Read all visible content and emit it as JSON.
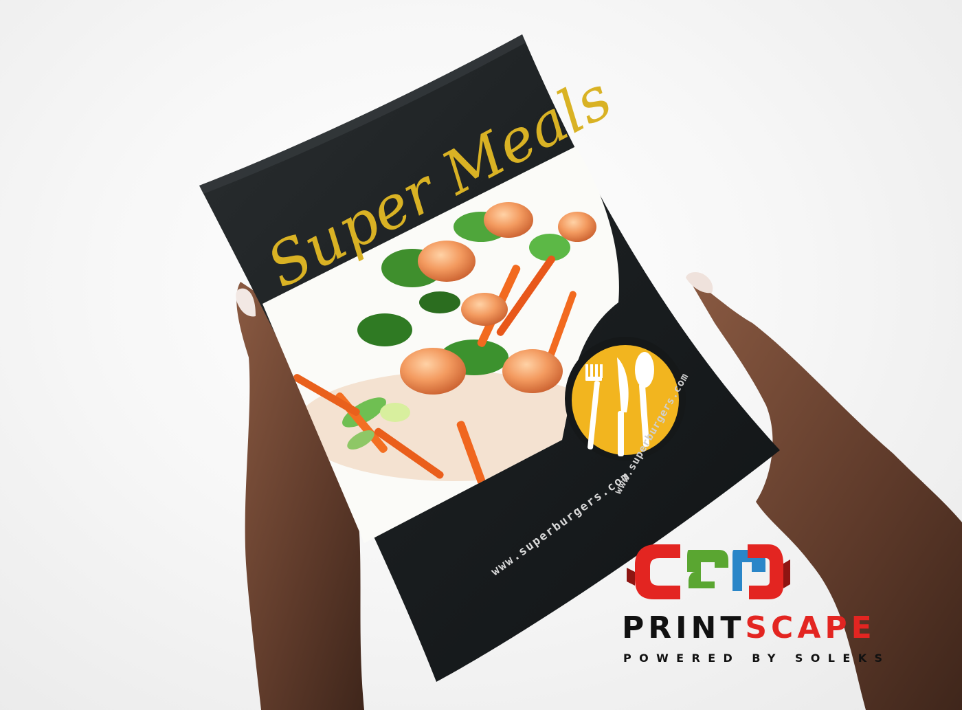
{
  "brochure": {
    "title": "Super Meals",
    "url": "www.superburgers.com",
    "photo": "shrimp-vegetable-salad",
    "icon": "fork-knife-spoon-icon",
    "colors": {
      "cover": "#1c2021",
      "title_gold": "#d9b224",
      "badge": "#f2b51f"
    }
  },
  "watermark": {
    "brand_part1": "PRINT",
    "brand_part2": "SCAPE",
    "tagline": "POWERED BY SOLEKS",
    "colors": {
      "dark": "#111111",
      "accent": "#e32521",
      "green": "#5aa631",
      "blue": "#2a86c8"
    }
  }
}
